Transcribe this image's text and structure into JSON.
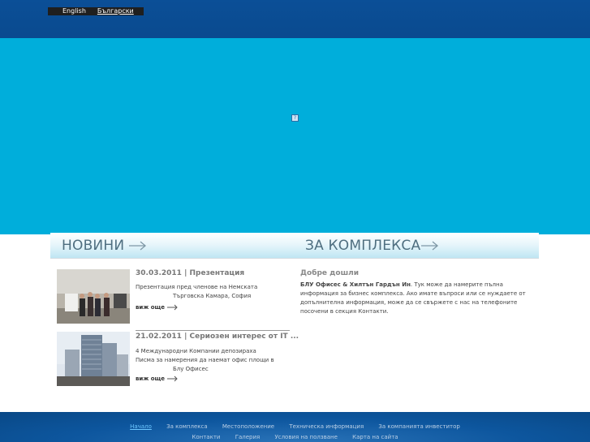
{
  "header": {
    "lang_en": "English",
    "lang_bg": "Български"
  },
  "sections": {
    "news_title": "НОВИНИ",
    "about_title": "ЗА КОМПЛЕКСА"
  },
  "news": [
    {
      "date_title": "30.03.2011 | Презентация",
      "line1": "Презентация пред членове на Немската",
      "line2": "Търговска Камара, София",
      "more": "виж още"
    },
    {
      "date_title": "21.02.2011 | Сериозен интерес от IT ...",
      "line1": "4 Международни    Компании депозираха",
      "line2": "Писма за намерения да наемат офис площи в",
      "line3": "Блу Офисес",
      "more": "виж още"
    }
  ],
  "about": {
    "welcome": "Добре дошли",
    "bold": "БЛУ Офисес & Хилтън Гардън Ин",
    "text": ". Тук може да намерите пълна информация за бизнес комплекса. Ако имате въпроси или се нуждаете от допълнителна информация, може да се свържете с нас на телефоните посочени в секция Контакти."
  },
  "footer": {
    "row1": [
      "Начало",
      "За комплекса",
      "Местоположение",
      "Техническа информация",
      "За компанията инвеститор"
    ],
    "row2": [
      "Контакти",
      "Галерия",
      "Условия на ползване",
      "Карта на сайта"
    ]
  }
}
